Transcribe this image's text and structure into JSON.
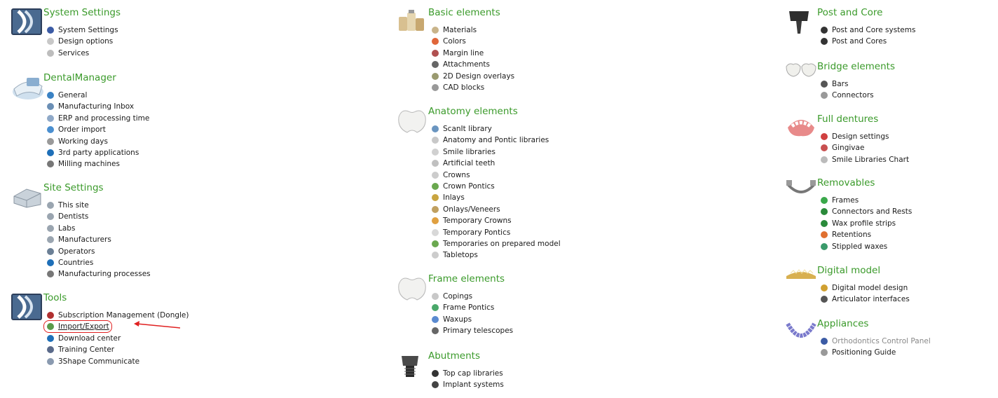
{
  "col1": [
    {
      "title": "System Settings",
      "icon": "app-logo-icon",
      "items": [
        {
          "label": "System Settings",
          "icon": "gear-3d-icon",
          "color": "#3b5ba5"
        },
        {
          "label": "Design options",
          "icon": "tooth-icon",
          "color": "#c8c8c8"
        },
        {
          "label": "Services",
          "icon": "cog-icon",
          "color": "#bdbdbd"
        }
      ]
    },
    {
      "title": "DentalManager",
      "icon": "dental-manager-icon",
      "items": [
        {
          "label": "General",
          "icon": "info-icon",
          "color": "#3a82c4"
        },
        {
          "label": "Manufacturing Inbox",
          "icon": "inbox-icon",
          "color": "#6b8fb5"
        },
        {
          "label": "ERP and processing time",
          "icon": "document-icon",
          "color": "#8fa9c8"
        },
        {
          "label": "Order import",
          "icon": "import-arrow-icon",
          "color": "#4a8fd0"
        },
        {
          "label": "Working days",
          "icon": "clock-icon",
          "color": "#999999"
        },
        {
          "label": "3rd party applications",
          "icon": "globe-icon",
          "color": "#1e6fb8"
        },
        {
          "label": "Milling machines",
          "icon": "drill-icon",
          "color": "#777777"
        }
      ]
    },
    {
      "title": "Site Settings",
      "icon": "building-icon",
      "items": [
        {
          "label": "This site",
          "icon": "server-icon",
          "color": "#9aa5b0"
        },
        {
          "label": "Dentists",
          "icon": "server-icon",
          "color": "#9aa5b0"
        },
        {
          "label": "Labs",
          "icon": "server-icon",
          "color": "#9aa5b0"
        },
        {
          "label": "Manufacturers",
          "icon": "server-icon",
          "color": "#9aa5b0"
        },
        {
          "label": "Operators",
          "icon": "users-icon",
          "color": "#6b7f95"
        },
        {
          "label": "Countries",
          "icon": "globe-icon",
          "color": "#1e6fb8"
        },
        {
          "label": "Manufacturing processes",
          "icon": "drill-icon",
          "color": "#777777"
        }
      ]
    },
    {
      "title": "Tools",
      "icon": "app-logo-icon",
      "items": [
        {
          "label": "Subscription Management (Dongle)",
          "icon": "dongle-icon",
          "color": "#b03030"
        },
        {
          "label": "Import/Export",
          "icon": "import-export-icon",
          "color": "#5a9a4a",
          "highlight": true
        },
        {
          "label": "Download center",
          "icon": "globe-icon",
          "color": "#1e6fb8"
        },
        {
          "label": "Training Center",
          "icon": "tools-icon",
          "color": "#5a6a8a"
        },
        {
          "label": "3Shape Communicate",
          "icon": "communicate-icon",
          "color": "#8a9ab0"
        }
      ]
    }
  ],
  "col2": [
    {
      "title": "Basic elements",
      "icon": "materials-bottles-icon",
      "items": [
        {
          "label": "Materials",
          "icon": "bottles-icon",
          "color": "#c9b48a"
        },
        {
          "label": "Colors",
          "icon": "color-palette-icon",
          "color": "#e0663a"
        },
        {
          "label": "Margin line",
          "icon": "tooth-red-icon",
          "color": "#b05050"
        },
        {
          "label": "Attachments",
          "icon": "attachment-icon",
          "color": "#666666"
        },
        {
          "label": "2D Design overlays",
          "icon": "overlay-icon",
          "color": "#9a9a70"
        },
        {
          "label": "CAD blocks",
          "icon": "cad-block-icon",
          "color": "#999999"
        }
      ]
    },
    {
      "title": "Anatomy elements",
      "icon": "crown-tooth-icon",
      "items": [
        {
          "label": "ScanIt library",
          "icon": "scan-icon",
          "color": "#6a95c0"
        },
        {
          "label": "Anatomy and Pontic libraries",
          "icon": "tooth-icon",
          "color": "#c8c8c8"
        },
        {
          "label": "Smile libraries",
          "icon": "smile-icon",
          "color": "#d0d0d0"
        },
        {
          "label": "Artificial teeth",
          "icon": "teeth-icon",
          "color": "#c0c0c0"
        },
        {
          "label": "Crowns",
          "icon": "tooth-icon",
          "color": "#cccccc"
        },
        {
          "label": "Crown Pontics",
          "icon": "tooth-green-icon",
          "color": "#6aa84f"
        },
        {
          "label": "Inlays",
          "icon": "inlay-icon",
          "color": "#c9a540"
        },
        {
          "label": "Onlays/Veneers",
          "icon": "veneer-icon",
          "color": "#c0a060"
        },
        {
          "label": "Temporary Crowns",
          "icon": "temp-crown-icon",
          "color": "#e0a040"
        },
        {
          "label": "Temporary Pontics",
          "icon": "tooth-icon",
          "color": "#d8d8d8"
        },
        {
          "label": "Temporaries on prepared model",
          "icon": "tooth-green-icon",
          "color": "#6aa84f"
        },
        {
          "label": "Tabletops",
          "icon": "tooth-icon",
          "color": "#cccccc"
        }
      ]
    },
    {
      "title": "Frame elements",
      "icon": "frame-tooth-icon",
      "items": [
        {
          "label": "Copings",
          "icon": "coping-icon",
          "color": "#c8c8c8"
        },
        {
          "label": "Frame Pontics",
          "icon": "tooth-green-icon",
          "color": "#4aa86a"
        },
        {
          "label": "Waxups",
          "icon": "waxup-icon",
          "color": "#5a8ad0"
        },
        {
          "label": "Primary telescopes",
          "icon": "telescope-icon",
          "color": "#666666"
        }
      ]
    },
    {
      "title": "Abutments",
      "icon": "abutment-icon",
      "items": [
        {
          "label": "Top cap libraries",
          "icon": "implant-icon",
          "color": "#333333"
        },
        {
          "label": "Implant systems",
          "icon": "implant-icon",
          "color": "#444444"
        }
      ]
    }
  ],
  "col3": [
    {
      "title": "Post and Core",
      "icon": "post-core-icon",
      "items": [
        {
          "label": "Post and Core systems",
          "icon": "post-icon",
          "color": "#333333"
        },
        {
          "label": "Post and Cores",
          "icon": "core-icon",
          "color": "#333333"
        }
      ]
    },
    {
      "title": "Bridge elements",
      "icon": "bridge-teeth-icon",
      "items": [
        {
          "label": "Bars",
          "icon": "bar-icon",
          "color": "#555555"
        },
        {
          "label": "Connectors",
          "icon": "connector-icon",
          "color": "#999999"
        }
      ]
    },
    {
      "title": "Full dentures",
      "icon": "denture-icon",
      "items": [
        {
          "label": "Design settings",
          "icon": "design-settings-icon",
          "color": "#d04040"
        },
        {
          "label": "Gingivae",
          "icon": "gingiva-icon",
          "color": "#c85050"
        },
        {
          "label": "Smile Libraries Chart",
          "icon": "chart-grid-icon",
          "color": "#bbbbbb"
        }
      ]
    },
    {
      "title": "Removables",
      "icon": "removable-frame-icon",
      "items": [
        {
          "label": "Frames",
          "icon": "frame-icon",
          "color": "#3aa84a"
        },
        {
          "label": "Connectors and Rests",
          "icon": "connector-rest-icon",
          "color": "#2a8a3a"
        },
        {
          "label": "Wax profile strips",
          "icon": "wax-strip-icon",
          "color": "#2a8a3a"
        },
        {
          "label": "Retentions",
          "icon": "retention-icon",
          "color": "#e07030"
        },
        {
          "label": "Stippled waxes",
          "icon": "stipple-icon",
          "color": "#3a9a6a"
        }
      ]
    },
    {
      "title": "Digital model",
      "icon": "digital-model-icon",
      "items": [
        {
          "label": "Digital model design",
          "icon": "model-icon",
          "color": "#d0a030"
        },
        {
          "label": "Articulator interfaces",
          "icon": "articulator-icon",
          "color": "#555555"
        }
      ]
    },
    {
      "title": "Appliances",
      "icon": "appliance-icon",
      "items": [
        {
          "label": "Orthodontics Control Panel",
          "icon": "ortho-icon",
          "color": "#3b5ba5",
          "muted": true
        },
        {
          "label": "Positioning Guide",
          "icon": "guide-icon",
          "color": "#999999"
        }
      ]
    }
  ]
}
